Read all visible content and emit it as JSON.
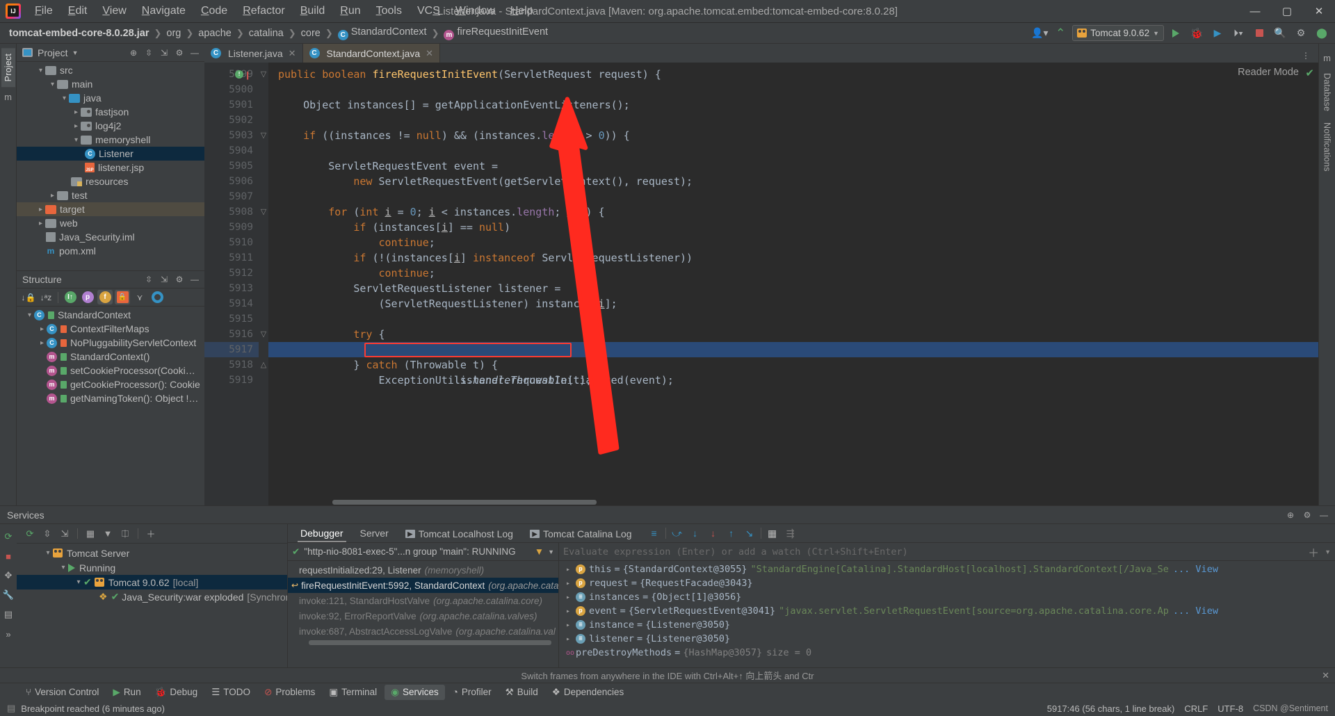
{
  "window": {
    "title": "Listener.java - StandardContext.java [Maven: org.apache.tomcat.embed:tomcat-embed-core:8.0.28]",
    "minimize": "—",
    "maximize": "▢",
    "close": "✕"
  },
  "menu": [
    "File",
    "Edit",
    "View",
    "Navigate",
    "Code",
    "Refactor",
    "Build",
    "Run",
    "Tools",
    "VCS",
    "Window",
    "Help"
  ],
  "breadcrumb": [
    {
      "label": "tomcat-embed-core-8.0.28.jar",
      "bold": true,
      "icon": ""
    },
    {
      "label": "org",
      "bold": false,
      "icon": ""
    },
    {
      "label": "apache",
      "bold": false,
      "icon": ""
    },
    {
      "label": "catalina",
      "bold": false,
      "icon": ""
    },
    {
      "label": "core",
      "bold": false,
      "icon": ""
    },
    {
      "label": "StandardContext",
      "bold": false,
      "icon": "class-icon"
    },
    {
      "label": "fireRequestInitEvent",
      "bold": false,
      "icon": "method-icon"
    }
  ],
  "toolbar": {
    "run_config": "Tomcat 9.0.62",
    "icons": [
      "user-icon",
      "build-hammer-icon",
      "run-icon",
      "debug-icon",
      "run-coverage-icon",
      "more-icon",
      "stop-icon",
      "search-icon",
      "settings-icon",
      "updates-icon"
    ]
  },
  "left_stripe": [
    "Project",
    "Maven"
  ],
  "right_stripe": [
    "Maven",
    "Database",
    "Notifications"
  ],
  "project_panel": {
    "title": "Project",
    "header_icons": [
      "locate-icon",
      "expand-all-icon",
      "collapse-all-icon",
      "settings-icon",
      "hide-icon"
    ],
    "tree": [
      {
        "label": "src",
        "indent": 1,
        "arrow": "▾",
        "icon": "folder-gray",
        "state": "normal"
      },
      {
        "label": "main",
        "indent": 2,
        "arrow": "▾",
        "icon": "folder-gray",
        "state": "normal"
      },
      {
        "label": "java",
        "indent": 3,
        "arrow": "▾",
        "icon": "folder-blue",
        "state": "normal"
      },
      {
        "label": "fastjson",
        "indent": 4,
        "arrow": "▸",
        "icon": "package-gray",
        "state": "normal"
      },
      {
        "label": "log4j2",
        "indent": 4,
        "arrow": "▸",
        "icon": "package-gray",
        "state": "normal"
      },
      {
        "label": "memoryshell",
        "indent": 4,
        "arrow": "▾",
        "icon": "package-blue",
        "state": "normal"
      },
      {
        "label": "Listener",
        "indent": 5,
        "arrow": "",
        "icon": "class-icon",
        "state": "selected"
      },
      {
        "label": "listener.jsp",
        "indent": 5,
        "arrow": "",
        "icon": "jsp-icon",
        "state": "normal"
      },
      {
        "label": "resources",
        "indent": 3,
        "arrow": "",
        "icon": "folder-resources",
        "state": "normal"
      },
      {
        "label": "test",
        "indent": 2,
        "arrow": "▸",
        "icon": "folder-gray",
        "state": "normal"
      },
      {
        "label": "target",
        "indent": 1,
        "arrow": "▸",
        "icon": "folder-orange",
        "state": "highlight"
      },
      {
        "label": "web",
        "indent": 1,
        "arrow": "▸",
        "icon": "folder-gray",
        "state": "normal"
      },
      {
        "label": "Java_Security.iml",
        "indent": 1,
        "arrow": "",
        "icon": "iml-icon",
        "state": "normal"
      },
      {
        "label": "pom.xml",
        "indent": 1,
        "arrow": "",
        "icon": "maven-icon",
        "state": "normal"
      }
    ]
  },
  "structure_panel": {
    "title": "Structure",
    "header_icons": [
      "expand-all-icon",
      "collapse-all-icon",
      "settings-icon",
      "hide-icon"
    ],
    "toolbar_icons": [
      "sort-by-visibility-icon",
      "sort-alphabetically-icon",
      "show-inherited-icon",
      "show-properties-icon",
      "show-fields-icon",
      "show-non-public-icon",
      "show-anonymous-icon",
      "show-cscopes-icon"
    ],
    "tree": [
      {
        "label": "StandardContext",
        "indent": 1,
        "arrow": "▾",
        "icon": "class-icon",
        "lock": "green"
      },
      {
        "label": "ContextFilterMaps",
        "indent": 2,
        "arrow": "▸",
        "icon": "inner-class-icon",
        "lock": "orange"
      },
      {
        "label": "NoPluggabilityServletContext",
        "indent": 2,
        "arrow": "▸",
        "icon": "inner-class-icon",
        "lock": "orange"
      },
      {
        "label": "StandardContext()",
        "indent": 2,
        "arrow": "",
        "icon": "method-icon",
        "lock": "green"
      },
      {
        "label": "setCookieProcessor(CookiePro",
        "indent": 2,
        "arrow": "",
        "icon": "method-icon",
        "lock": "green"
      },
      {
        "label": "getCookieProcessor(): Cookie",
        "indent": 2,
        "arrow": "",
        "icon": "method-icon",
        "lock": "green"
      },
      {
        "label": "getNamingToken(): Object !Co",
        "indent": 2,
        "arrow": "",
        "icon": "method-icon",
        "lock": "green"
      }
    ]
  },
  "editor": {
    "tabs": [
      {
        "label": "Listener.java",
        "active": false,
        "icon": "class-icon"
      },
      {
        "label": "StandardContext.java",
        "active": true,
        "icon": "class-icon"
      }
    ],
    "reader_mode": "Reader Mode",
    "first_line": 5899,
    "current_line": 5917,
    "lines": [
      {
        "n": 5899,
        "breakpoint": true,
        "fold": "▽",
        "segments": [
          [
            "kw",
            "    public "
          ],
          [
            "kw",
            "boolean "
          ],
          [
            "fn",
            "fireRequestInitEvent"
          ],
          [
            "pln",
            "(ServletRequest request) {"
          ]
        ]
      },
      {
        "n": 5900,
        "segments": [
          [
            "pln",
            ""
          ]
        ]
      },
      {
        "n": 5901,
        "segments": [
          [
            "pln",
            "        Object instances[] = getApplicationEventListeners();"
          ]
        ]
      },
      {
        "n": 5902,
        "segments": [
          [
            "pln",
            ""
          ]
        ]
      },
      {
        "n": 5903,
        "fold": "▽",
        "segments": [
          [
            "pln",
            "        "
          ],
          [
            "kw",
            "if "
          ],
          [
            "pln",
            "((instances != "
          ],
          [
            "kw",
            "null"
          ],
          [
            "pln",
            ") && (instances."
          ],
          [
            "fld",
            "length"
          ],
          [
            "pln",
            " > "
          ],
          [
            "num",
            "0"
          ],
          [
            "pln",
            ")) {"
          ]
        ]
      },
      {
        "n": 5904,
        "segments": [
          [
            "pln",
            ""
          ]
        ]
      },
      {
        "n": 5905,
        "segments": [
          [
            "pln",
            "            ServletRequestEvent event ="
          ]
        ]
      },
      {
        "n": 5906,
        "segments": [
          [
            "pln",
            "                "
          ],
          [
            "kw",
            "new "
          ],
          [
            "pln",
            "ServletRequestEvent(getServletContext(), request);"
          ]
        ]
      },
      {
        "n": 5907,
        "segments": [
          [
            "pln",
            ""
          ]
        ]
      },
      {
        "n": 5908,
        "fold": "▽",
        "segments": [
          [
            "pln",
            "            "
          ],
          [
            "kw",
            "for "
          ],
          [
            "pln",
            "("
          ],
          [
            "kw",
            "int "
          ],
          [
            "und",
            "i"
          ],
          [
            "pln",
            " = "
          ],
          [
            "num",
            "0"
          ],
          [
            "pln",
            "; "
          ],
          [
            "und",
            "i"
          ],
          [
            "pln",
            " < instances."
          ],
          [
            "fld",
            "length"
          ],
          [
            "pln",
            "; "
          ],
          [
            "und",
            "i"
          ],
          [
            "pln",
            "++) {"
          ]
        ]
      },
      {
        "n": 5909,
        "segments": [
          [
            "pln",
            "                "
          ],
          [
            "kw",
            "if "
          ],
          [
            "pln",
            "(instances["
          ],
          [
            "und",
            "i"
          ],
          [
            "pln",
            "] == "
          ],
          [
            "kw",
            "null"
          ],
          [
            "pln",
            ")"
          ]
        ]
      },
      {
        "n": 5910,
        "segments": [
          [
            "pln",
            "                    "
          ],
          [
            "kw",
            "continue"
          ],
          [
            "pln",
            ";"
          ]
        ]
      },
      {
        "n": 5911,
        "segments": [
          [
            "pln",
            "                "
          ],
          [
            "kw",
            "if "
          ],
          [
            "pln",
            "(!(instances["
          ],
          [
            "und",
            "i"
          ],
          [
            "pln",
            "] "
          ],
          [
            "kw",
            "instanceof "
          ],
          [
            "pln",
            "ServletRequestListener))"
          ]
        ]
      },
      {
        "n": 5912,
        "segments": [
          [
            "pln",
            "                    "
          ],
          [
            "kw",
            "continue"
          ],
          [
            "pln",
            ";"
          ]
        ]
      },
      {
        "n": 5913,
        "segments": [
          [
            "pln",
            "                ServletRequestListener listener ="
          ]
        ]
      },
      {
        "n": 5914,
        "segments": [
          [
            "pln",
            "                    (ServletRequestListener) instances["
          ],
          [
            "und",
            "i"
          ],
          [
            "pln",
            "];"
          ]
        ]
      },
      {
        "n": 5915,
        "segments": [
          [
            "pln",
            ""
          ]
        ]
      },
      {
        "n": 5916,
        "fold": "▽",
        "segments": [
          [
            "pln",
            "                "
          ],
          [
            "kw",
            "try "
          ],
          [
            "pln",
            "{"
          ]
        ]
      },
      {
        "n": 5917,
        "current": true,
        "boxed": true,
        "segments": [
          [
            "pln",
            "                    listener.requestInitialized(event);"
          ]
        ]
      },
      {
        "n": 5918,
        "fold": "△",
        "segments": [
          [
            "pln",
            "                } "
          ],
          [
            "kw",
            "catch "
          ],
          [
            "pln",
            "(Throwable t) {"
          ]
        ]
      },
      {
        "n": 5919,
        "segments": [
          [
            "pln",
            "                    ExceptionUtils."
          ],
          [
            "ital",
            "handleThrowable"
          ],
          [
            "pln",
            "(t);"
          ]
        ]
      }
    ]
  },
  "services": {
    "title": "Services",
    "header_icons": [
      "add-service-icon",
      "settings-icon",
      "hide-icon"
    ],
    "toolbar_icons": [
      "rerun-icon",
      "expand-icon",
      "collapse-icon",
      "group-icon",
      "filter-icon",
      "show-icon",
      "add-icon"
    ],
    "tree": [
      {
        "label": "Tomcat Server",
        "indent": 1,
        "arrow": "▾",
        "icon": "tomcat-icon",
        "state": "normal"
      },
      {
        "label": "Running",
        "indent": 2,
        "arrow": "▾",
        "icon": "run-green-icon",
        "state": "normal"
      },
      {
        "label": "Tomcat 9.0.62",
        "suffix": "[local]",
        "indent": 3,
        "arrow": "▾",
        "icon": "tomcat-icon",
        "state": "selected"
      },
      {
        "label": "Java_Security:war exploded",
        "suffix": "[Synchronize",
        "indent": 4,
        "arrow": "",
        "icon": "artifact-icon",
        "state": "normal"
      }
    ]
  },
  "debugger": {
    "tabs": [
      {
        "label": "Debugger",
        "active": true,
        "icon": ""
      },
      {
        "label": "Server",
        "active": false,
        "icon": ""
      },
      {
        "label": "Tomcat Localhost Log",
        "active": false,
        "icon": "console-icon"
      },
      {
        "label": "Tomcat Catalina Log",
        "active": false,
        "icon": "console-icon"
      }
    ],
    "step_icons": [
      "mute-breakpoints-icon",
      "step-over-icon",
      "step-into-icon",
      "force-step-into-icon",
      "step-out-icon",
      "run-to-cursor-icon",
      "evaluate-icon",
      "settings-icon"
    ],
    "thread_selector": "\"http-nio-8081-exec-5\"...n group \"main\": RUNNING",
    "frames": [
      {
        "label": "requestInitialized:29, Listener",
        "pkg": "(memoryshell)",
        "selected": false,
        "dim": false,
        "arrow": false
      },
      {
        "label": "fireRequestInitEvent:5992, StandardContext",
        "pkg": "(org.apache.cata",
        "selected": true,
        "dim": false,
        "arrow": true
      },
      {
        "label": "invoke:121, StandardHostValve",
        "pkg": "(org.apache.catalina.core)",
        "selected": false,
        "dim": true,
        "arrow": false
      },
      {
        "label": "invoke:92, ErrorReportValve",
        "pkg": "(org.apache.catalina.valves)",
        "selected": false,
        "dim": true,
        "arrow": false
      },
      {
        "label": "invoke:687, AbstractAccessLogValve",
        "pkg": "(org.apache.catalina.val",
        "selected": false,
        "dim": true,
        "arrow": false
      }
    ],
    "watch_placeholder": "Evaluate expression (Enter) or add a watch (Ctrl+Shift+Enter)",
    "variables": [
      {
        "chev": "▸",
        "badge": "p",
        "name": "this",
        "value": "{StandardContext@3055}",
        "str": "\"StandardEngine[Catalina].StandardHost[localhost].StandardContext[/Java_Se",
        "link": "... View"
      },
      {
        "chev": "▸",
        "badge": "p",
        "name": "request",
        "value": "{RequestFacade@3043}",
        "str": "",
        "link": ""
      },
      {
        "chev": "▸",
        "badge": "",
        "name": "instances",
        "value": "{Object[1]@3056}",
        "str": "",
        "link": ""
      },
      {
        "chev": "▸",
        "badge": "p",
        "name": "event",
        "value": "{ServletRequestEvent@3041}",
        "str": "\"javax.servlet.ServletRequestEvent[source=org.apache.catalina.core.Ap",
        "link": "... View"
      },
      {
        "chev": "▸",
        "badge": "",
        "name": "instance",
        "value": "{Listener@3050}",
        "str": "",
        "link": ""
      },
      {
        "chev": "▸",
        "badge": "",
        "name": "listener",
        "value": "{Listener@3050}",
        "str": "",
        "link": ""
      },
      {
        "chev": "oo",
        "badge": "",
        "name": "preDestroyMethods",
        "value": "{HashMap@3057}",
        "str": "",
        "link": "",
        "extra": "size = 0"
      }
    ],
    "tip": "Switch frames from anywhere in the IDE with Ctrl+Alt+↑ 向上箭头 and Ctr"
  },
  "bottom_tabs": [
    {
      "label": "Version Control",
      "icon": "vcs-icon",
      "active": false
    },
    {
      "label": "Run",
      "icon": "run-icon",
      "active": false
    },
    {
      "label": "Debug",
      "icon": "debug-icon",
      "active": false
    },
    {
      "label": "TODO",
      "icon": "todo-icon",
      "active": false
    },
    {
      "label": "Problems",
      "icon": "problems-icon",
      "active": false
    },
    {
      "label": "Terminal",
      "icon": "terminal-icon",
      "active": false
    },
    {
      "label": "Services",
      "icon": "services-icon",
      "active": true
    },
    {
      "label": "Profiler",
      "icon": "profiler-icon",
      "active": false
    },
    {
      "label": "Build",
      "icon": "build-icon",
      "active": false
    },
    {
      "label": "Dependencies",
      "icon": "dependencies-icon",
      "active": false
    }
  ],
  "statusbar": {
    "message": "Breakpoint reached (6 minutes ago)",
    "caret": "5917:46 (56 chars, 1 line break)",
    "line_sep": "CRLF",
    "encoding": "UTF-8",
    "watermark": "CSDN @Sentiment"
  }
}
